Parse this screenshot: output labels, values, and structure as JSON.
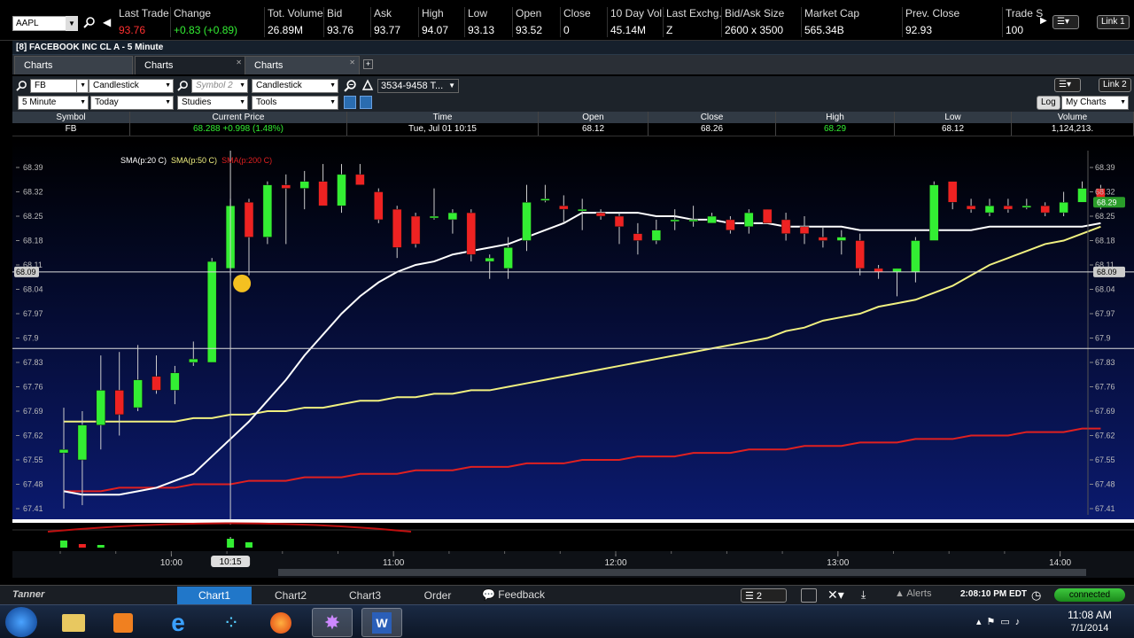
{
  "quote": {
    "symbol": "AAPL",
    "columns": [
      {
        "h": "Last Trade",
        "v": "93.76",
        "c": "red"
      },
      {
        "h": "Change",
        "v": "+0.83 (+0.89)",
        "c": "green"
      },
      {
        "h": "Tot. Volume",
        "v": "26.89M",
        "c": ""
      },
      {
        "h": "Bid",
        "v": "93.76",
        "c": ""
      },
      {
        "h": "Ask",
        "v": "93.77",
        "c": ""
      },
      {
        "h": "High",
        "v": "94.07",
        "c": ""
      },
      {
        "h": "Low",
        "v": "93.13",
        "c": ""
      },
      {
        "h": "Open",
        "v": "93.52",
        "c": ""
      },
      {
        "h": "Close",
        "v": "0",
        "c": ""
      },
      {
        "h": "10 Day Vol.",
        "v": "45.14M",
        "c": ""
      },
      {
        "h": "Last Exchg.",
        "v": "Z",
        "c": ""
      },
      {
        "h": "Bid/Ask Size",
        "v": "2600 x 3500",
        "c": ""
      },
      {
        "h": "Market Cap",
        "v": "565.34B",
        "c": ""
      },
      {
        "h": "Prev. Close",
        "v": "92.93",
        "c": ""
      },
      {
        "h": "Trade S",
        "v": "100",
        "c": ""
      }
    ],
    "link": "Link 1"
  },
  "window": {
    "title": "[8] FACEBOOK INC CL A - 5 Minute",
    "tabs": [
      "Charts",
      "Charts",
      "Charts"
    ],
    "add_tab": "+"
  },
  "toolbar": {
    "symbol": "FB",
    "chart_type": "Candlestick",
    "symbol2_placeholder": "Symbol 2",
    "chart_type2": "Candlestick",
    "account": "3534-9458 T...",
    "interval": "5 Minute",
    "range": "Today",
    "studies": "Studies",
    "tools": "Tools",
    "log": "Log",
    "my_charts": "My Charts",
    "link": "Link 2"
  },
  "info": {
    "headers": [
      "Symbol",
      "Current Price",
      "Time",
      "Open",
      "Close",
      "High",
      "Low",
      "Volume"
    ],
    "values": [
      "FB",
      "68.288 +0.998 (1.48%)",
      "Tue, Jul 01  10:15",
      "68.12",
      "68.26",
      "68.29",
      "68.12",
      "1,124,213."
    ]
  },
  "chart_data": {
    "type": "candlestick",
    "legend": [
      {
        "name": "SMA(p:20 C)",
        "color": "#ffffff"
      },
      {
        "name": "SMA(p:50 C)",
        "color": "#f0f080"
      },
      {
        "name": "SMA(p:200 C)",
        "color": "#e02020"
      }
    ],
    "y_ticks": [
      "68.39",
      "68.32",
      "68.25",
      "68.18",
      "68.11",
      "68.04",
      "67.97",
      "67.9",
      "67.83",
      "67.76",
      "67.69",
      "67.62",
      "67.55",
      "67.48",
      "67.41"
    ],
    "ylim": [
      67.41,
      68.39
    ],
    "x_ticks": [
      "10:00",
      "11:00",
      "12:00",
      "13:00",
      "14:00"
    ],
    "crosshair_time": "10:15",
    "crosshair_index": 9,
    "horizontal_line_price": "68.09",
    "last_price": "68.29",
    "candles": [
      [
        67.57,
        67.58,
        67.41,
        67.7
      ],
      [
        67.55,
        67.65,
        67.42,
        67.69
      ],
      [
        67.65,
        67.75,
        67.58,
        67.85
      ],
      [
        67.75,
        67.68,
        67.62,
        67.86
      ],
      [
        67.7,
        67.78,
        67.69,
        67.88
      ],
      [
        67.79,
        67.75,
        67.74,
        67.85
      ],
      [
        67.75,
        67.8,
        67.71,
        67.82
      ],
      [
        67.83,
        67.84,
        67.82,
        67.89
      ],
      [
        67.83,
        68.12,
        67.83,
        68.13
      ],
      [
        68.1,
        68.28,
        68.08,
        68.3
      ],
      [
        68.29,
        68.19,
        68.08,
        68.3
      ],
      [
        68.19,
        68.34,
        68.17,
        68.35
      ],
      [
        68.34,
        68.33,
        68.17,
        68.37
      ],
      [
        68.33,
        68.35,
        68.27,
        68.38
      ],
      [
        68.35,
        68.28,
        68.28,
        68.4
      ],
      [
        68.28,
        68.37,
        68.26,
        68.4
      ],
      [
        68.37,
        68.34,
        68.34,
        68.4
      ],
      [
        68.32,
        68.24,
        68.23,
        68.33
      ],
      [
        68.27,
        68.16,
        68.13,
        68.28
      ],
      [
        68.25,
        68.17,
        68.16,
        68.26
      ],
      [
        68.25,
        68.25,
        68.24,
        68.33
      ],
      [
        68.24,
        68.26,
        68.2,
        68.27
      ],
      [
        68.26,
        68.14,
        68.12,
        68.27
      ],
      [
        68.12,
        68.13,
        68.07,
        68.14
      ],
      [
        68.1,
        68.16,
        68.07,
        68.19
      ],
      [
        68.18,
        68.29,
        68.15,
        68.34
      ],
      [
        68.3,
        68.3,
        68.29,
        68.34
      ],
      [
        68.28,
        68.27,
        68.23,
        68.31
      ],
      [
        68.27,
        68.27,
        68.21,
        68.3
      ],
      [
        68.26,
        68.25,
        68.24,
        68.27
      ],
      [
        68.25,
        68.22,
        68.17,
        68.26
      ],
      [
        68.2,
        68.18,
        68.14,
        68.23
      ],
      [
        68.18,
        68.21,
        68.17,
        68.24
      ],
      [
        68.24,
        68.24,
        68.21,
        68.27
      ],
      [
        68.24,
        68.24,
        68.22,
        68.28
      ],
      [
        68.23,
        68.25,
        68.24,
        68.26
      ],
      [
        68.24,
        68.21,
        68.2,
        68.25
      ],
      [
        68.22,
        68.26,
        68.2,
        68.27
      ],
      [
        68.27,
        68.23,
        68.23,
        68.27
      ],
      [
        68.24,
        68.2,
        68.18,
        68.26
      ],
      [
        68.22,
        68.2,
        68.17,
        68.25
      ],
      [
        68.19,
        68.18,
        68.16,
        68.22
      ],
      [
        68.18,
        68.19,
        68.14,
        68.21
      ],
      [
        68.18,
        68.1,
        68.08,
        68.2
      ],
      [
        68.1,
        68.09,
        68.07,
        68.11
      ],
      [
        68.09,
        68.1,
        68.02,
        68.1
      ],
      [
        68.09,
        68.18,
        68.06,
        68.19
      ],
      [
        68.18,
        68.34,
        68.18,
        68.35
      ],
      [
        68.35,
        68.29,
        68.27,
        68.35
      ],
      [
        68.28,
        68.27,
        68.26,
        68.3
      ],
      [
        68.26,
        68.28,
        68.25,
        68.3
      ],
      [
        68.28,
        68.27,
        68.26,
        68.3
      ],
      [
        68.28,
        68.28,
        68.27,
        68.3
      ],
      [
        68.28,
        68.26,
        68.25,
        68.29
      ],
      [
        68.26,
        68.29,
        68.25,
        68.32
      ],
      [
        68.29,
        68.33,
        68.29,
        68.35
      ],
      [
        68.33,
        68.29,
        68.27,
        68.34
      ]
    ],
    "sma20": [
      67.46,
      67.45,
      67.45,
      67.45,
      67.46,
      67.47,
      67.49,
      67.51,
      67.56,
      67.61,
      67.66,
      67.72,
      67.78,
      67.85,
      67.91,
      67.97,
      68.02,
      68.06,
      68.09,
      68.11,
      68.12,
      68.14,
      68.15,
      68.16,
      68.17,
      68.19,
      68.21,
      68.23,
      68.26,
      68.26,
      68.26,
      68.26,
      68.25,
      68.25,
      68.24,
      68.24,
      68.23,
      68.23,
      68.23,
      68.22,
      68.22,
      68.22,
      68.22,
      68.21,
      68.21,
      68.21,
      68.21,
      68.21,
      68.21,
      68.21,
      68.22,
      68.22,
      68.22,
      68.22,
      68.22,
      68.22,
      68.23
    ],
    "sma50": [
      67.66,
      67.66,
      67.66,
      67.66,
      67.66,
      67.66,
      67.66,
      67.67,
      67.67,
      67.68,
      67.68,
      67.69,
      67.69,
      67.7,
      67.7,
      67.71,
      67.72,
      67.72,
      67.73,
      67.73,
      67.74,
      67.74,
      67.75,
      67.75,
      67.76,
      67.77,
      67.78,
      67.79,
      67.8,
      67.81,
      67.82,
      67.83,
      67.84,
      67.85,
      67.86,
      67.87,
      67.88,
      67.89,
      67.9,
      67.92,
      67.93,
      67.95,
      67.96,
      67.97,
      67.99,
      68.0,
      68.01,
      68.03,
      68.05,
      68.08,
      68.11,
      68.13,
      68.15,
      68.17,
      68.18,
      68.2,
      68.22
    ],
    "sma200": [
      67.46,
      67.46,
      67.46,
      67.47,
      67.47,
      67.47,
      67.47,
      67.48,
      67.48,
      67.48,
      67.49,
      67.49,
      67.49,
      67.5,
      67.5,
      67.5,
      67.51,
      67.51,
      67.51,
      67.52,
      67.52,
      67.52,
      67.53,
      67.53,
      67.53,
      67.54,
      67.54,
      67.54,
      67.55,
      67.55,
      67.55,
      67.56,
      67.56,
      67.56,
      67.57,
      67.57,
      67.57,
      67.58,
      67.58,
      67.58,
      67.59,
      67.59,
      67.59,
      67.6,
      67.6,
      67.6,
      67.61,
      67.61,
      67.61,
      67.62,
      67.62,
      67.62,
      67.63,
      67.63,
      67.63,
      67.64,
      67.64
    ]
  },
  "bottom": {
    "user": "Tanner",
    "tabs": [
      "Chart1",
      "Chart2",
      "Chart3",
      "Order"
    ],
    "feedback": "Feedback",
    "layout_count": "2",
    "alerts": "Alerts",
    "clock": "2:08:10 PM EDT",
    "status": "connected"
  },
  "taskbar": {
    "time": "11:08 AM",
    "date": "7/1/2014"
  },
  "colors": {
    "up": "#33ee33",
    "down": "#ee2222",
    "sma20": "#ffffff",
    "sma50": "#f0f080",
    "sma200": "#e02020",
    "accent": "#2177c9"
  }
}
